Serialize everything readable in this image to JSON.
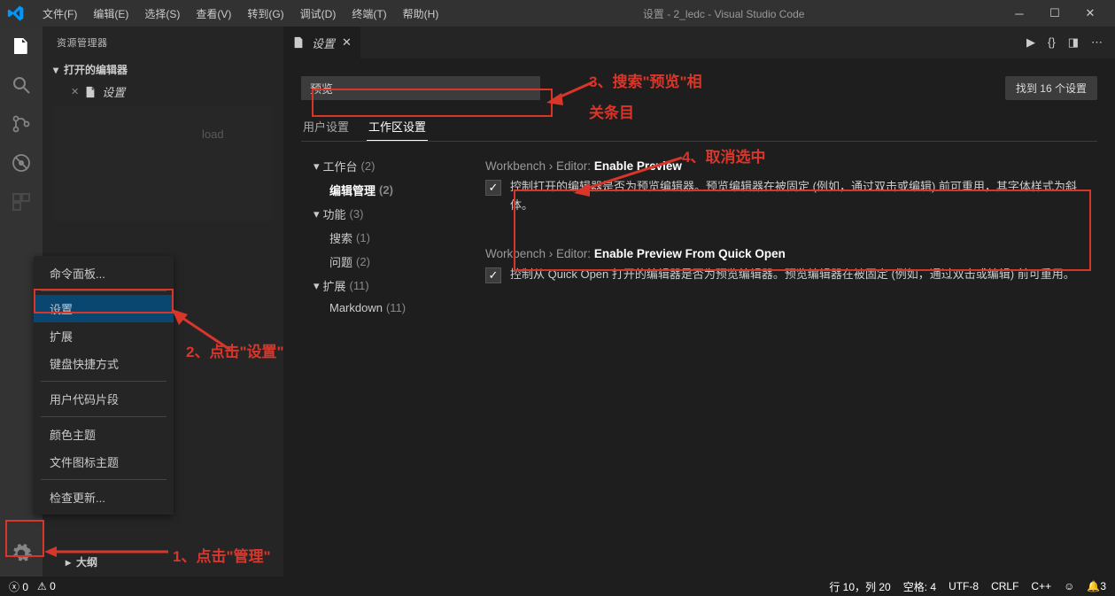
{
  "titlebar": {
    "menus": [
      "文件(F)",
      "编辑(E)",
      "选择(S)",
      "查看(V)",
      "转到(G)",
      "调试(D)",
      "终端(T)",
      "帮助(H)"
    ],
    "title": "设置 - 2_ledc - Visual Studio Code"
  },
  "sidebar": {
    "header": "资源管理器",
    "open_editors": "打开的编辑器",
    "open_item": "设置",
    "outline": "大纲",
    "blur_label": "load"
  },
  "context_menu": {
    "items": [
      {
        "label": "命令面板...",
        "sep": false
      },
      {
        "label": "设置",
        "sep": true,
        "highlight": true
      },
      {
        "label": "扩展",
        "sep": false
      },
      {
        "label": "键盘快捷方式",
        "sep": false
      },
      {
        "label": "用户代码片段",
        "sep": true
      },
      {
        "label": "颜色主题",
        "sep": true
      },
      {
        "label": "文件图标主题",
        "sep": false
      },
      {
        "label": "检查更新...",
        "sep": true
      }
    ]
  },
  "tab": {
    "label": "设置"
  },
  "search": {
    "value": "预览",
    "results": "找到 16 个设置"
  },
  "settings_tabs": {
    "user": "用户设置",
    "workspace": "工作区设置"
  },
  "toc": [
    {
      "label": "工作台",
      "count": "(2)",
      "expand": true
    },
    {
      "label": "编辑管理",
      "count": "(2)",
      "sub": true,
      "bold": true
    },
    {
      "label": "功能",
      "count": "(3)",
      "expand": true
    },
    {
      "label": "搜索",
      "count": "(1)",
      "sub": true
    },
    {
      "label": "问题",
      "count": "(2)",
      "sub": true
    },
    {
      "label": "扩展",
      "count": "(11)",
      "expand": true
    },
    {
      "label": "Markdown",
      "count": "(11)",
      "sub": true
    }
  ],
  "settings": [
    {
      "breadcrumb": "Workbench › Editor: ",
      "name": "Enable Preview",
      "checked": true,
      "desc": "控制打开的编辑器是否为预览编辑器。预览编辑器在被固定 (例如，通过双击或编辑) 前可重用，其字体样式为斜体。"
    },
    {
      "breadcrumb": "Workbench › Editor: ",
      "name": "Enable Preview From Quick Open",
      "checked": true,
      "desc": "控制从 Quick Open 打开的编辑器是否为预览编辑器。预览编辑器在被固定 (例如，通过双击或编辑) 前可重用。"
    }
  ],
  "statusbar": {
    "errors": "0",
    "warnings": "0",
    "ln_col": "行 10，列 20",
    "spaces": "空格: 4",
    "enc": "UTF-8",
    "eol": "CRLF",
    "lang": "C++",
    "bell": "3"
  },
  "annotations": {
    "a1": "1、点击\"管理\"",
    "a2": "2、点击\"设置\"",
    "a3": "3、搜索\"预览\"相关条目",
    "a3a": "3、搜索\"预览\"相",
    "a3b": "关条目",
    "a4": "4、取消选中"
  }
}
